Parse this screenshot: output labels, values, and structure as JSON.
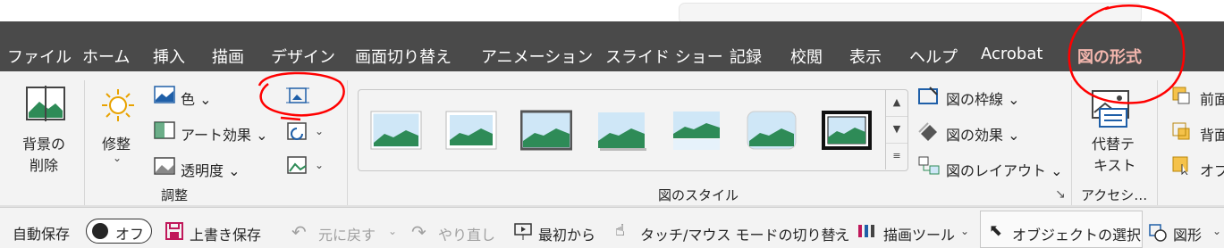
{
  "tabs": [
    {
      "label": "ファイル"
    },
    {
      "label": "ホーム"
    },
    {
      "label": "挿入"
    },
    {
      "label": "描画"
    },
    {
      "label": "デザイン"
    },
    {
      "label": "画面切り替え"
    },
    {
      "label": "アニメーション"
    },
    {
      "label": "スライド ショー"
    },
    {
      "label": "記録"
    },
    {
      "label": "校閲"
    },
    {
      "label": "表示"
    },
    {
      "label": "ヘルプ"
    },
    {
      "label": "Acrobat"
    },
    {
      "label": "図の形式"
    }
  ],
  "ribbon": {
    "remove_bg": {
      "line1": "背景の",
      "line2": "削除"
    },
    "corrections": {
      "label": "修整",
      "chevron": "⌄"
    },
    "color": {
      "label": "色 ⌄"
    },
    "artistic": {
      "label": "アート効果 ⌄"
    },
    "transparency": {
      "label": "透明度 ⌄"
    },
    "adjust_group": "調整",
    "styles_group": "図のスタイル",
    "border": {
      "label": "図の枠線 ⌄"
    },
    "effects": {
      "label": "図の効果 ⌄"
    },
    "layout": {
      "label": "図のレイアウト ⌄"
    },
    "alt_text": {
      "line1": "代替テ",
      "line2": "キスト"
    },
    "access_group": "アクセシ…",
    "bring_forward": "前面",
    "send_backward": "背面",
    "selection_pane": "オブ",
    "dialog_launcher": "↘"
  },
  "qat": {
    "autosave": "自動保存",
    "autosave_state": "オフ",
    "save": "上書き保存",
    "undo": "元に戻す",
    "redo": "やり直し",
    "from_start": "最初から",
    "touch_mode": "タッチ/マウス モードの切り替え",
    "draw_tools": "描画ツール",
    "select_objects": "オブジェクトの選択",
    "shapes": "図形"
  },
  "colors": {
    "titlebar": "#4a4a4a",
    "ribbon": "#f3f3f3",
    "active_tab": "#f3b6ad",
    "annotation": "#ff0000"
  }
}
